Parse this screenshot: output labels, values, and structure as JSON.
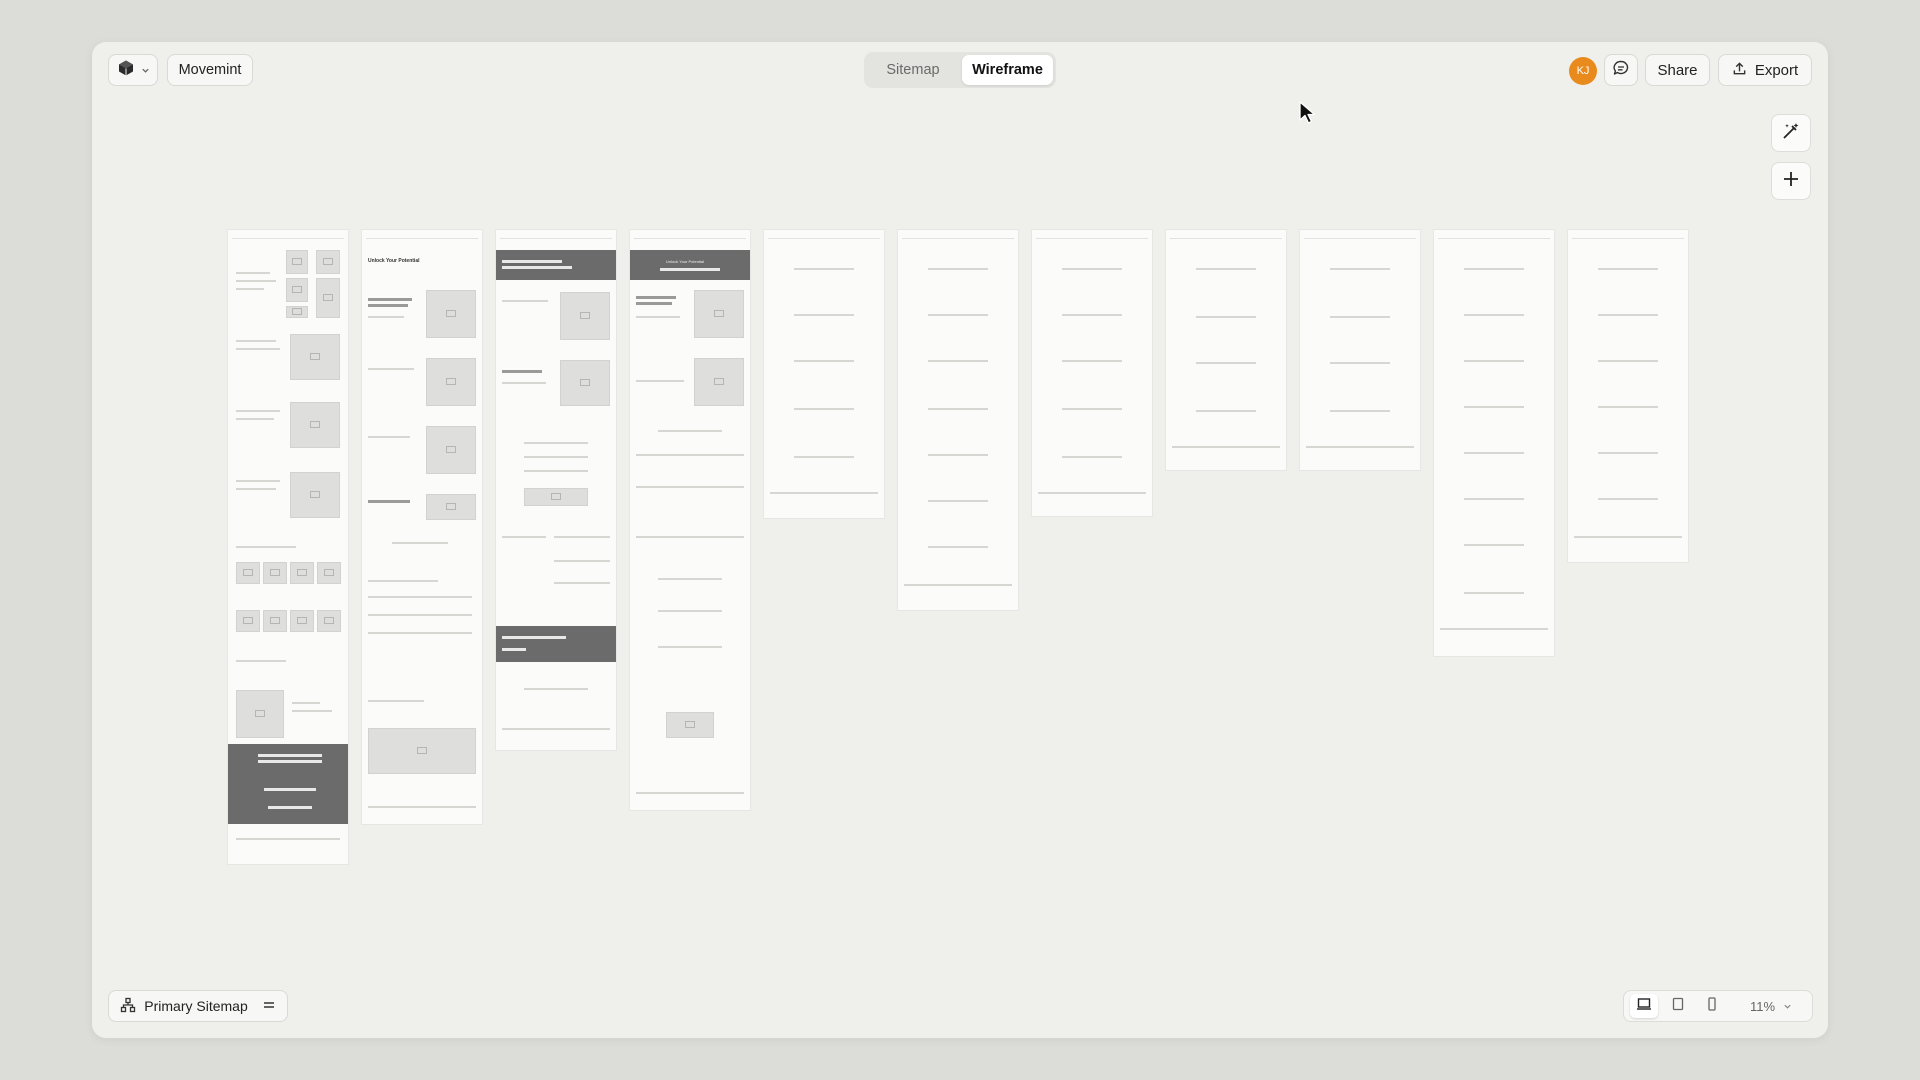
{
  "app": {
    "project_name": "Movemint",
    "logo_icon": "cube-icon"
  },
  "view_toggle": {
    "sitemap": "Sitemap",
    "wireframe": "Wireframe",
    "active": "Wireframe"
  },
  "header": {
    "avatar_initials": "KJ",
    "avatar_color": "#e98a1c",
    "share": "Share",
    "export": "Export"
  },
  "sitemap_selector": {
    "label": "Primary Sitemap"
  },
  "zoom": {
    "level": "11%",
    "device": "desktop"
  },
  "wireframe_titles": {
    "page2": "Unlock Your Potential",
    "page4": "Unlock Your Potential"
  }
}
